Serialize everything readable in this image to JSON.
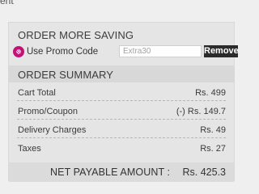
{
  "header_fragment": "ent",
  "saving": {
    "title": "ORDER MORE SAVING",
    "promo_label": "Use Promo Code",
    "promo_placeholder": "Extra30",
    "remove_label": "Remove"
  },
  "summary": {
    "title": "ORDER SUMMARY",
    "rows": [
      {
        "label": "Cart Total",
        "value": "Rs. 499"
      },
      {
        "label": "Promo/Coupon",
        "value": "(-) Rs. 149.7"
      },
      {
        "label": "Delivery Charges",
        "value": "Rs. 49"
      },
      {
        "label": "Taxes",
        "value": "Rs. 27"
      }
    ],
    "total_label": "NET PAYABLE AMOUNT :",
    "total_value": "Rs. 425.3"
  },
  "colors": {
    "accent": "#c2127a",
    "button_bg": "#2b2b2b"
  },
  "icons": {
    "radio": "promo-radio-icon"
  }
}
